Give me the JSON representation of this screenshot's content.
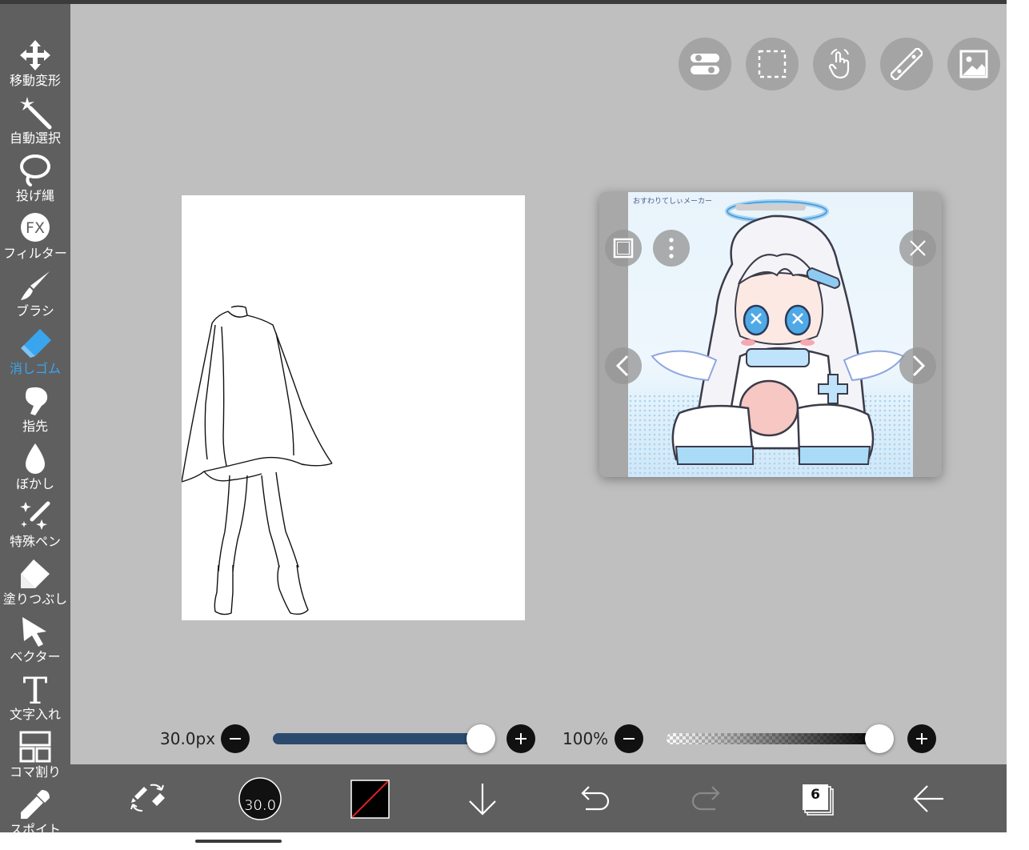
{
  "tools": [
    {
      "label": "移動変形",
      "icon": "move-arrows-icon",
      "active": false
    },
    {
      "label": "自動選択",
      "icon": "magic-wand-icon",
      "active": false
    },
    {
      "label": "投げ縄",
      "icon": "lasso-icon",
      "active": false
    },
    {
      "label": "フィルター",
      "icon": "fx-filter-icon",
      "active": false
    },
    {
      "label": "ブラシ",
      "icon": "brush-icon",
      "active": false
    },
    {
      "label": "消しゴム",
      "icon": "eraser-icon",
      "active": true
    },
    {
      "label": "指先",
      "icon": "finger-smudge-icon",
      "active": false
    },
    {
      "label": "ぼかし",
      "icon": "blur-drop-icon",
      "active": false
    },
    {
      "label": "特殊ペン",
      "icon": "special-pen-icon",
      "active": false
    },
    {
      "label": "塗りつぶし",
      "icon": "fill-bucket-icon",
      "active": false
    },
    {
      "label": "ベクター",
      "icon": "vector-cursor-icon",
      "active": false
    },
    {
      "label": "文字入れ",
      "icon": "text-t-icon",
      "active": false
    },
    {
      "label": "コマ割り",
      "icon": "frame-divide-icon",
      "active": false
    },
    {
      "label": "スポイト",
      "icon": "eyedropper-icon",
      "active": false
    }
  ],
  "top_buttons": [
    "toggle-switch-icon",
    "selection-marquee-icon",
    "touch-hand-icon",
    "ruler-icon",
    "reference-image-icon"
  ],
  "reference_window": {
    "caption": "おすわりてしぃメーカー",
    "buttons": [
      "frame-toggle-icon",
      "more-vertical-icon",
      "close-icon",
      "prev-chevron-icon",
      "next-chevron-icon"
    ]
  },
  "brush_size": {
    "value_text": "30.0px",
    "fraction": 1.0
  },
  "opacity": {
    "value_text": "100%",
    "fraction": 1.0
  },
  "bottom_bar": {
    "brush_size_badge": "30.0",
    "layer_count": "6",
    "icons": [
      "swap-brush-eraser-icon",
      "brush-size-circle-icon",
      "color-swatch-icon",
      "save-down-arrow-icon",
      "undo-icon",
      "redo-icon",
      "layers-icon",
      "back-arrow-icon"
    ]
  },
  "colors": {
    "toolbar_bg": "#5f5f5f",
    "canvas_bg": "#bfbfbf",
    "active_tool": "#3aa5ef",
    "size_fill": "#2c4a6e"
  }
}
